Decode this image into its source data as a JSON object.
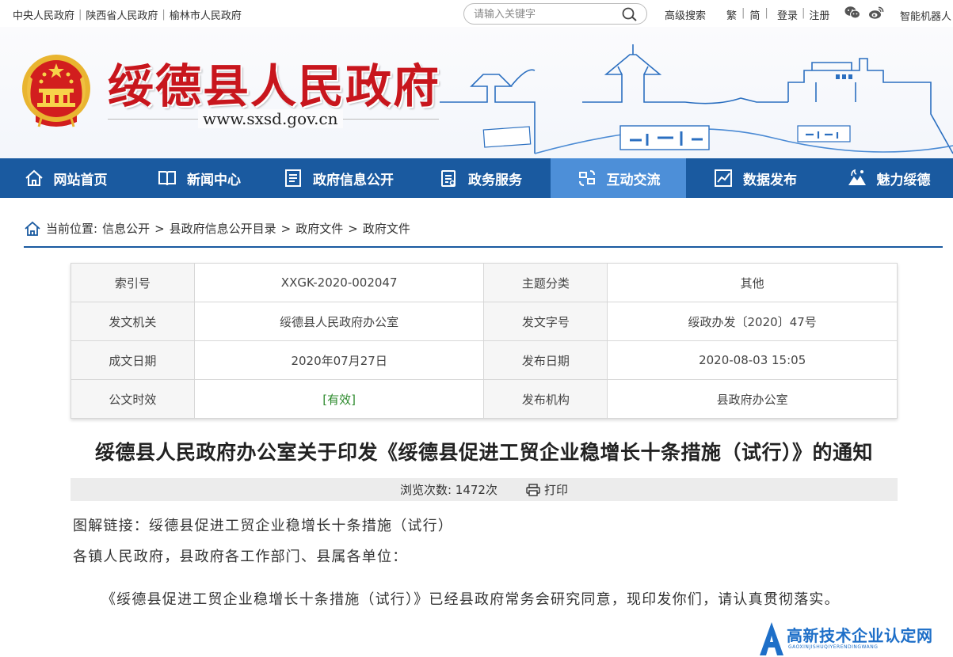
{
  "topbar": {
    "links": [
      "中央人民政府",
      "陕西省人民政府",
      "榆林市人民政府"
    ],
    "search_placeholder": "请输入关键字",
    "advanced_search": "高级搜索",
    "traditional": "繁",
    "simplified": "简",
    "login": "登录",
    "register": "注册",
    "robot": "智能机器人"
  },
  "header": {
    "site_title": "绥德县人民政府",
    "url": "www.sxsd.gov.cn"
  },
  "nav": {
    "items": [
      {
        "label": "网站首页",
        "icon": "home-icon"
      },
      {
        "label": "新闻中心",
        "icon": "book-icon"
      },
      {
        "label": "政府信息公开",
        "icon": "document-icon"
      },
      {
        "label": "政务服务",
        "icon": "clipboard-icon"
      },
      {
        "label": "互动交流",
        "icon": "interaction-icon"
      },
      {
        "label": "数据发布",
        "icon": "chart-icon"
      },
      {
        "label": "魅力绥德",
        "icon": "landscape-icon"
      }
    ],
    "active_index": 4
  },
  "breadcrumb": {
    "prefix": "当前位置:",
    "items": [
      "信息公开",
      "县政府信息公开目录",
      "政府文件",
      "政府文件"
    ]
  },
  "meta": {
    "rows": [
      {
        "k1": "索引号",
        "v1": "XXGK-2020-002047",
        "k2": "主题分类",
        "v2": "其他"
      },
      {
        "k1": "发文机关",
        "v1": "绥德县人民政府办公室",
        "k2": "发文字号",
        "v2": "绥政办发〔2020〕47号"
      },
      {
        "k1": "成文日期",
        "v1": "2020年07月27日",
        "k2": "发布日期",
        "v2": "2020-08-03 15:05"
      },
      {
        "k1": "公文时效",
        "v1": "[有效]",
        "k2": "发布机构",
        "v2": "县政府办公室"
      }
    ]
  },
  "article": {
    "title": "绥德县人民政府办公室关于印发《绥德县促进工贸企业稳增长十条措施（试行）》的通知",
    "views": "浏览次数: 1472次",
    "print": "打印",
    "link_line": "图解链接：绥德县促进工贸企业稳增长十条措施（试行）",
    "salutation": "各镇人民政府，县政府各工作部门、县属各单位：",
    "paragraph": "《绥德县促进工贸企业稳增长十条措施（试行）》已经县政府常务会研究同意，现印发你们，请认真贯彻落实。"
  },
  "watermark": {
    "text": "高新技术企业认定网",
    "sub": "GAOXINJISHUQIYERENDINGWANG"
  },
  "colors": {
    "nav": "#1a5aa0",
    "nav_active": "#4d8fd8",
    "title_red": "#c8161d",
    "valid_green": "#2e8b2e"
  }
}
